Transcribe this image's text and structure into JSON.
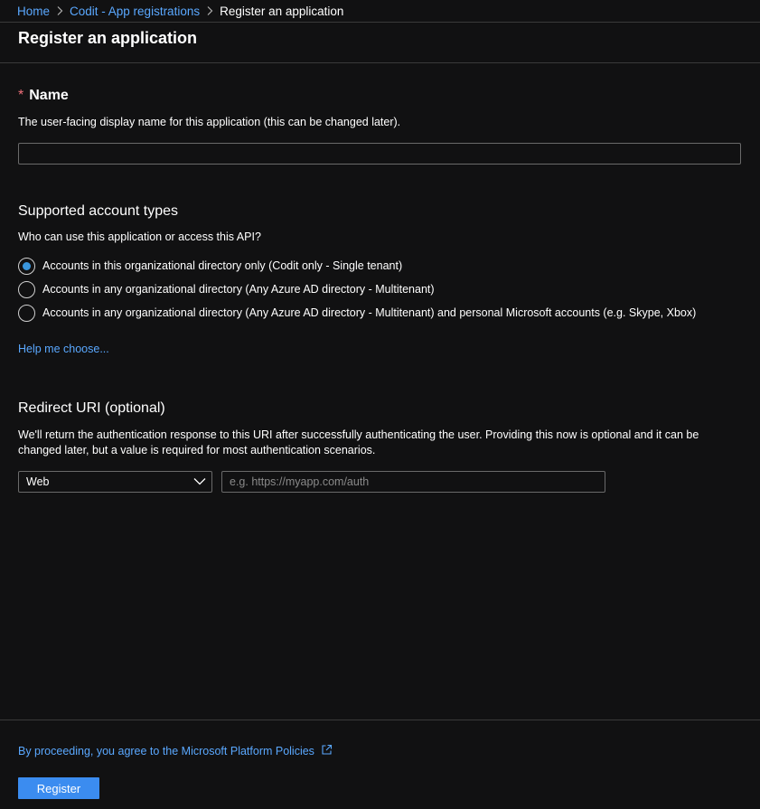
{
  "breadcrumb": {
    "items": [
      "Home",
      "Codit - App registrations"
    ],
    "current": "Register an application"
  },
  "page": {
    "title": "Register an application"
  },
  "name_section": {
    "required_mark": "*",
    "title": "Name",
    "description": "The user-facing display name for this application (this can be changed later).",
    "input_value": ""
  },
  "account_types": {
    "title": "Supported account types",
    "question": "Who can use this application or access this API?",
    "options": [
      "Accounts in this organizational directory only (Codit only - Single tenant)",
      "Accounts in any organizational directory (Any Azure AD directory - Multitenant)",
      "Accounts in any organizational directory (Any Azure AD directory - Multitenant) and personal Microsoft accounts (e.g. Skype, Xbox)"
    ],
    "selected_index": 0,
    "help_link": "Help me choose..."
  },
  "redirect": {
    "title": "Redirect URI (optional)",
    "description_line1": "We'll return the authentication response to this URI after successfully authenticating the user. Providing this now is optional and it can be",
    "description_line2": "changed later, but a value is required for most authentication scenarios.",
    "platform_selected": "Web",
    "uri_placeholder": "e.g. https://myapp.com/auth"
  },
  "footer": {
    "policy_text": "By proceeding, you agree to the Microsoft Platform Policies",
    "register_label": "Register"
  },
  "colors": {
    "background": "#111112",
    "link": "#5aa8ff",
    "accent": "#3b8cf0",
    "required": "#f1707b"
  }
}
